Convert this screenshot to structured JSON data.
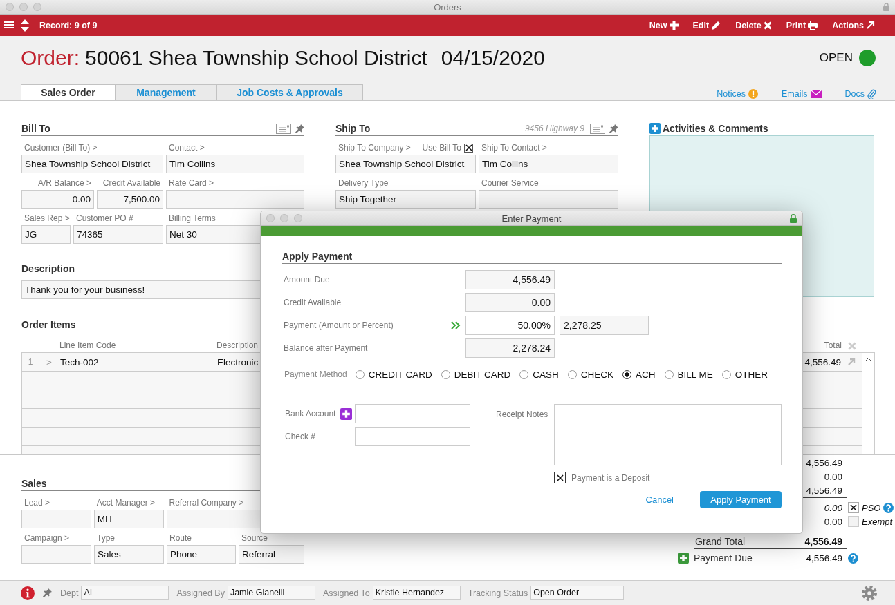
{
  "window": {
    "title": "Orders"
  },
  "toolbar": {
    "record": "Record: 9 of 9",
    "actions": [
      {
        "label": "New",
        "kind": "new"
      },
      {
        "label": "Edit",
        "kind": "edit"
      },
      {
        "label": "Delete",
        "kind": "delete"
      },
      {
        "label": "Print",
        "kind": "print"
      },
      {
        "label": "Actions",
        "kind": "actions"
      }
    ]
  },
  "header": {
    "prefix": "Order:",
    "title": "50061 Shea Township School District",
    "date": "04/15/2020",
    "status": "OPEN"
  },
  "tabs": [
    {
      "label": "Sales Order",
      "selected": true
    },
    {
      "label": "Management",
      "selected": false
    },
    {
      "label": "Job Costs & Approvals",
      "selected": false
    }
  ],
  "links": [
    {
      "label": "Notices",
      "kind": "notices"
    },
    {
      "label": "Emails",
      "kind": "emails"
    },
    {
      "label": "Docs",
      "kind": "docs"
    }
  ],
  "bill_to": {
    "title": "Bill To",
    "fields": [
      {
        "label": "Customer (Bill To) >",
        "value": "Shea Township School District",
        "kind": "text"
      },
      {
        "label": "Contact >",
        "value": "Tim Collins",
        "kind": "text"
      },
      {
        "label": "A/R Balance >",
        "value": "0.00",
        "kind": "amount"
      },
      {
        "label": "Credit Available",
        "value": "7,500.00",
        "kind": "amount"
      },
      {
        "label": "Rate Card >",
        "kind": "text"
      },
      {
        "label": "Sales Rep >",
        "value": "JG",
        "kind": "text"
      },
      {
        "label": "Customer PO #",
        "value": "74365",
        "kind": "text"
      },
      {
        "label": "Billing Terms",
        "value": "Net 30",
        "kind": "text"
      }
    ]
  },
  "ship_to": {
    "title": "Ship To",
    "address": "9456 Highway 9",
    "use_bill_to": {
      "label": "Use Bill To",
      "checked": true
    },
    "fields": [
      {
        "label": "Ship To Company >",
        "value": "Shea Township School District",
        "kind": "text"
      },
      {
        "label": "Ship To Contact >",
        "value": "Tim Collins",
        "kind": "text"
      },
      {
        "label": "Delivery Type",
        "value": "Ship Together",
        "kind": "text"
      },
      {
        "label": "Courier Service",
        "kind": "text"
      }
    ]
  },
  "activities": {
    "title": "Activities & Comments"
  },
  "description": {
    "title": "Description",
    "value": "Thank you for your business!"
  },
  "order_items": {
    "title": "Order Items",
    "columns": [
      "Line Item Code",
      "Description",
      "Total"
    ],
    "rows": [
      {
        "number": "1",
        "expander": ">",
        "code": "Tech-002",
        "description": "Electronic",
        "total": "4,556.49"
      }
    ]
  },
  "sales": {
    "title": "Sales",
    "fields": [
      {
        "label": "Lead >",
        "kind": "text"
      },
      {
        "label": "Acct Manager >",
        "value": "MH",
        "kind": "text"
      },
      {
        "label": "Referral Company >",
        "kind": "text"
      },
      {
        "label": "Campaign >",
        "kind": "text"
      },
      {
        "label": "Type",
        "value": "Sales",
        "kind": "text"
      },
      {
        "label": "Route",
        "value": "Phone",
        "kind": "text"
      },
      {
        "label": "Source",
        "value": "Referral",
        "kind": "text"
      }
    ]
  },
  "totals": [
    {
      "kind": "plain",
      "value": "4,556.49"
    },
    {
      "kind": "plain",
      "value": "0.00"
    },
    {
      "kind": "subtotal",
      "value": "4,556.49"
    },
    {
      "kind": "tax",
      "value": "0.00",
      "option": "PSO",
      "checked": true
    },
    {
      "kind": "exempt",
      "value": "0.00",
      "option": "Exempt",
      "checked": false
    },
    {
      "kind": "grand",
      "label": "Grand Total",
      "value": "4,556.49"
    },
    {
      "kind": "due",
      "label": "Payment Due",
      "value": "4,556.49"
    }
  ],
  "status_bar": {
    "fields": [
      {
        "label": "Dept",
        "value": "AI"
      },
      {
        "label": "Assigned By",
        "value": "Jamie Gianelli"
      },
      {
        "label": "Assigned To",
        "value": "Kristie Hernandez"
      },
      {
        "label": "Tracking Status",
        "value": "Open Order"
      }
    ]
  },
  "dialog": {
    "title": "Enter Payment",
    "section": "Apply Payment",
    "amounts": [
      {
        "label": "Amount Due",
        "value": "4,556.49",
        "kind": "readonly"
      },
      {
        "label": "Credit Available",
        "value": "0.00",
        "kind": "readonly"
      },
      {
        "label": "Payment (Amount or Percent)",
        "value": "50.00%",
        "amount": "2,278.25",
        "kind": "input"
      },
      {
        "label": "Balance after Payment",
        "value": "2,278.24",
        "kind": "readonly"
      }
    ],
    "payment_method": {
      "label": "Payment Method",
      "options": [
        {
          "label": "CREDIT CARD",
          "selected": false
        },
        {
          "label": "DEBIT CARD",
          "selected": false
        },
        {
          "label": "CASH",
          "selected": false
        },
        {
          "label": "CHECK",
          "selected": false
        },
        {
          "label": "ACH",
          "selected": true
        },
        {
          "label": "BILL ME",
          "selected": false
        },
        {
          "label": "OTHER",
          "selected": false
        }
      ]
    },
    "bank_account": {
      "label": "Bank Account"
    },
    "check_number": {
      "label": "Check #"
    },
    "receipt_notes": {
      "label": "Receipt Notes"
    },
    "deposit": {
      "label": "Payment is a Deposit",
      "checked": true
    },
    "buttons": [
      {
        "label": "Cancel",
        "kind": "link"
      },
      {
        "label": "Apply Payment",
        "kind": "primary"
      }
    ]
  }
}
